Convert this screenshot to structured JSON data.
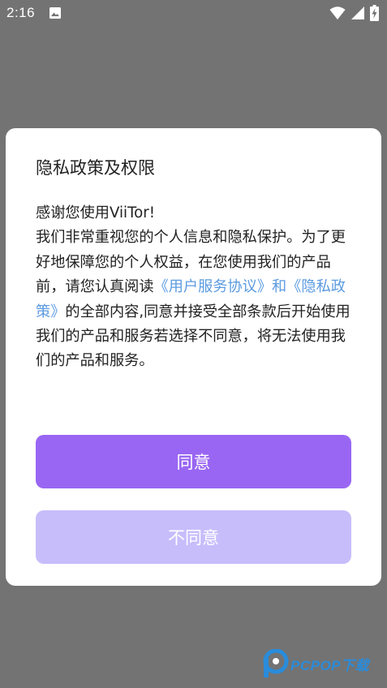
{
  "status_bar": {
    "time": "2:16",
    "icons": [
      "image-icon",
      "wifi-icon",
      "signal-icon",
      "battery-charging-icon"
    ]
  },
  "dialog": {
    "title": "隐私政策及权限",
    "greeting": "感谢您使用ViiTor!",
    "body_part1": " 我们非常重视您的个人信息和隐私保护。为了更好地保障您的个人权益，在您使用我们的产品前，请您认真阅读",
    "link_user_agreement": "《用户服务协议》",
    "conjunction": "和",
    "link_privacy_policy": "《隐私政策》",
    "body_part2": "的全部内容,同意并接受全部条款后开始使用我们的产品和服务若选择不同意，将无法使用我们的产品和服务。",
    "agree_label": "同意",
    "disagree_label": "不同意"
  },
  "colors": {
    "overlay": "#737373",
    "dialog_bg": "#ffffff",
    "link": "#5b9be0",
    "agree_button": "#9966f3",
    "disagree_button": "#c7bdfb",
    "watermark": "#2a8cdb"
  },
  "watermark": {
    "text": "PCPOP下载",
    "icon": "pcpop-logo-icon"
  }
}
